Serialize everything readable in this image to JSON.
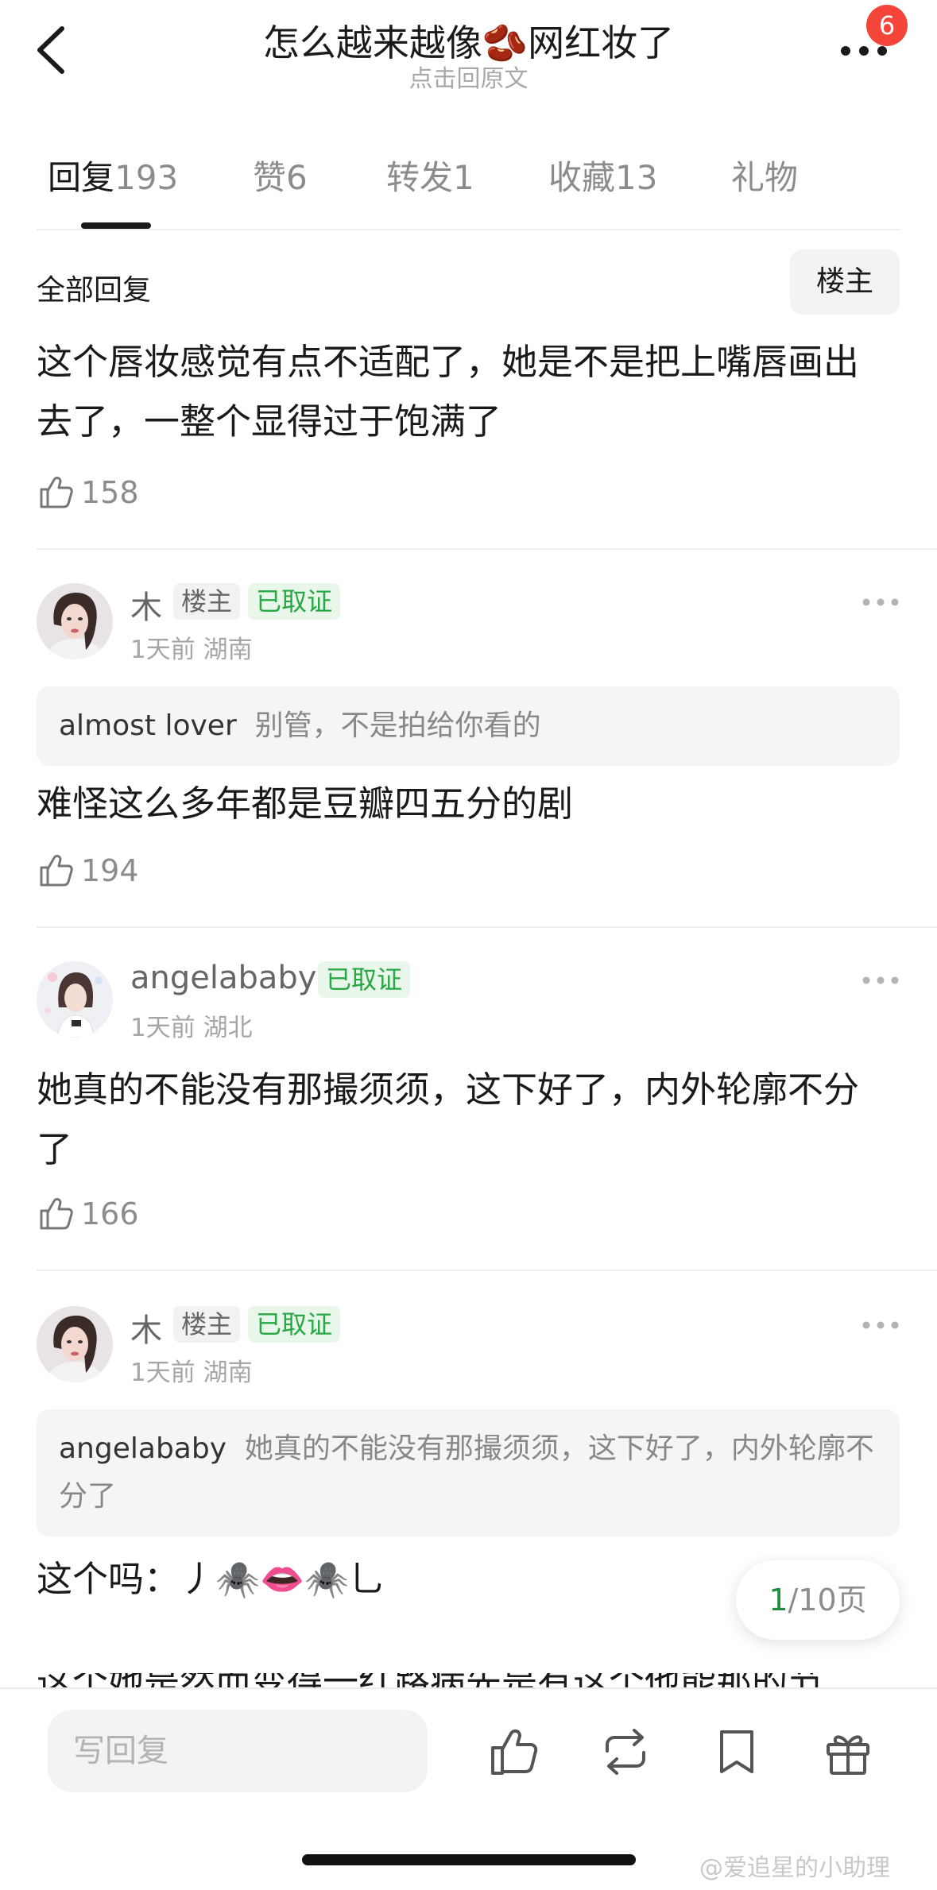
{
  "header": {
    "title": "怎么越来越像🫘网红妆了",
    "subtitle": "点击回原文",
    "notification_count": "6"
  },
  "tabs": [
    {
      "label": "回复",
      "count": "193",
      "active": true
    },
    {
      "label": "赞",
      "count": "6"
    },
    {
      "label": "转发",
      "count": "1"
    },
    {
      "label": "收藏",
      "count": "13"
    },
    {
      "label": "礼物",
      "count": ""
    }
  ],
  "filter": {
    "label": "全部回复",
    "op_only_button": "楼主"
  },
  "comments": [
    {
      "body": "这个唇妆感觉有点不适配了，她是不是把上嘴唇画出去了，一整个显得过于饱满了",
      "likes": "158"
    },
    {
      "username": "木",
      "op_tag": "楼主",
      "verified_tag": "已取证",
      "time": "1天前",
      "location": "湖南",
      "quote_name": "almost lover",
      "quote_text": "别管，不是拍给你看的",
      "body": "难怪这么多年都是豆瓣四五分的剧",
      "likes": "194"
    },
    {
      "username": "angelababy",
      "verified_tag": "已取证",
      "time": "1天前",
      "location": "湖北",
      "body": "她真的不能没有那撮须须，这下好了，内外轮廓不分了",
      "likes": "166"
    },
    {
      "username": "木",
      "op_tag": "楼主",
      "verified_tag": "已取证",
      "time": "1天前",
      "location": "湖南",
      "quote_name": "angelababy",
      "quote_text": "她真的不能没有那撮须须，这下好了，内外轮廓不分了",
      "body": "这个吗：丿🕷️👄🕷️乚"
    }
  ],
  "next_comment_cutoff": "这个她是然而变得一红路病先是有这个他能那的节",
  "pager": {
    "current": "1",
    "total_text": "/10页"
  },
  "bottom_bar": {
    "reply_placeholder": "写回复"
  },
  "watermark": "@爱追星的小助理",
  "colors": {
    "accent_green": "#27a844",
    "badge_red": "#f5453a"
  }
}
